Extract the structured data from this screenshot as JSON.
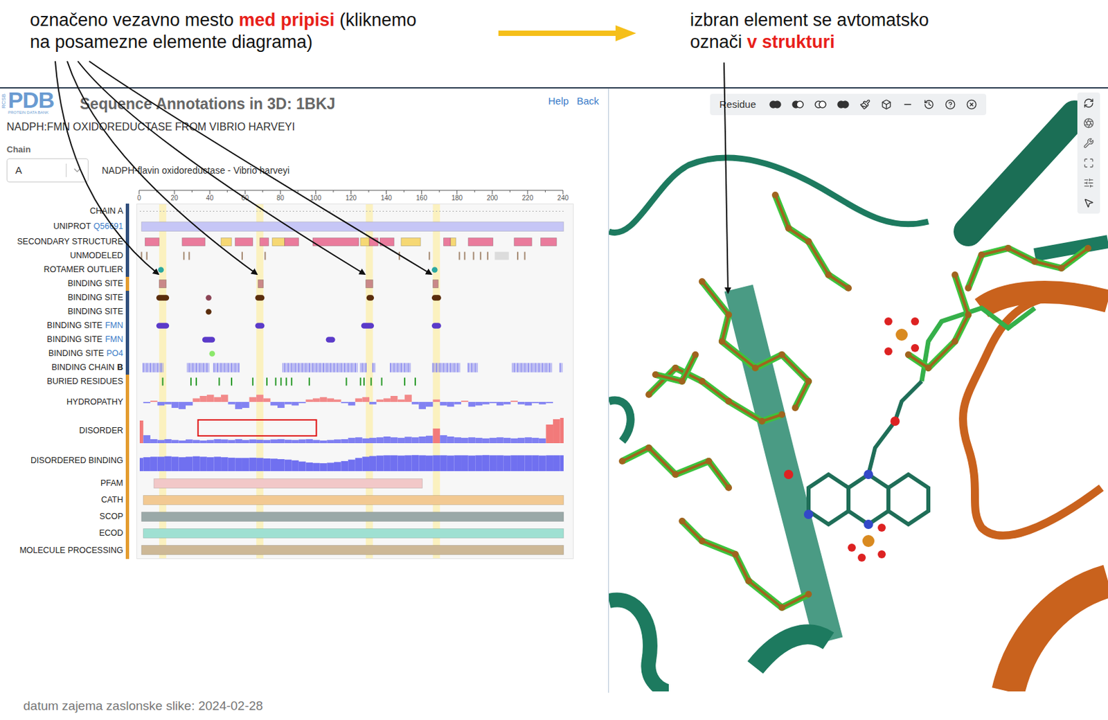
{
  "annotations": {
    "left": [
      [
        {
          "text": "označeno vezavno mesto ",
          "emphasis": false
        },
        {
          "text": "med pripisi",
          "emphasis": true
        },
        {
          "text": " (kliknemo",
          "emphasis": false
        }
      ],
      [
        {
          "text": "na posamezne elemente diagrama)",
          "emphasis": false
        }
      ]
    ],
    "right": [
      [
        {
          "text": "izbran element se avtomatsko",
          "emphasis": false
        }
      ],
      [
        {
          "text": "označi ",
          "emphasis": false
        },
        {
          "text": "v strukturi",
          "emphasis": true
        }
      ]
    ]
  },
  "header": {
    "logo_side": "RCSB",
    "logo_main": "PDB",
    "logo_sub": "PROTEIN DATA BANK",
    "title": "Sequence Annotations in 3D: 1BKJ",
    "links": [
      "Help",
      "Back"
    ]
  },
  "molecule": "NADPH:FMN OXIDOREDUCTASE FROM VIBRIO HARVEYI",
  "chain_select": {
    "label": "Chain",
    "value": "A",
    "description": "NADPH-flavin oxidoreductase - Vibrio harveyi"
  },
  "chart": {
    "axis_ticks": [
      "0",
      "20",
      "40",
      "60",
      "80",
      "100",
      "120",
      "140",
      "160",
      "180",
      "200",
      "220",
      "240"
    ],
    "highlights": [
      {
        "start": 11,
        "end": 15
      },
      {
        "start": 66,
        "end": 70
      },
      {
        "start": 128,
        "end": 132
      },
      {
        "start": 166,
        "end": 170
      }
    ],
    "tracks": [
      {
        "label": "CHAIN A",
        "group_color": "#2e4d7b",
        "kind": "line",
        "features": [
          {
            "start": 0,
            "end": 240,
            "color": "#b0b0b0"
          }
        ]
      },
      {
        "label": "UNIPROT",
        "tag": "Q56691",
        "tag_style": "link",
        "group_color": "#2e4d7b",
        "kind": "bar",
        "features": [
          {
            "start": 1,
            "end": 240,
            "color": "#c6c6f6"
          }
        ]
      },
      {
        "label": "SECONDARY STRUCTURE",
        "group_color": "#2e4d7b",
        "kind": "box",
        "features": [
          {
            "start": 3,
            "end": 11,
            "color": "#ea7b9c"
          },
          {
            "start": 24,
            "end": 37,
            "color": "#ea7b9c"
          },
          {
            "start": 46,
            "end": 52,
            "color": "#f6d874"
          },
          {
            "start": 54,
            "end": 64,
            "color": "#ea7b9c"
          },
          {
            "start": 68,
            "end": 73,
            "color": "#ea7b9c"
          },
          {
            "start": 75,
            "end": 82,
            "color": "#f6d874"
          },
          {
            "start": 82,
            "end": 90,
            "color": "#ea7b9c"
          },
          {
            "start": 98,
            "end": 124,
            "color": "#ea7b9c"
          },
          {
            "start": 125,
            "end": 130,
            "color": "#f6d874"
          },
          {
            "start": 130,
            "end": 135,
            "color": "#ea7b9c"
          },
          {
            "start": 136,
            "end": 144,
            "color": "#ea7b9c"
          },
          {
            "start": 148,
            "end": 159,
            "color": "#f6d874"
          },
          {
            "start": 172,
            "end": 176,
            "color": "#ea7b9c"
          },
          {
            "start": 176,
            "end": 179,
            "color": "#f6d874"
          },
          {
            "start": 186,
            "end": 200,
            "color": "#ea7b9c"
          },
          {
            "start": 212,
            "end": 222,
            "color": "#ea7b9c"
          },
          {
            "start": 227,
            "end": 236,
            "color": "#ea7b9c"
          }
        ]
      },
      {
        "label": "UNMODELED",
        "group_color": "#2e4d7b",
        "kind": "tick",
        "features": [
          {
            "start": 1,
            "end": 1,
            "color": "#a58a72"
          },
          {
            "start": 4,
            "end": 4,
            "color": "#a58a72"
          },
          {
            "start": 25,
            "end": 25,
            "color": "#a58a72"
          },
          {
            "start": 28,
            "end": 28,
            "color": "#a58a72"
          },
          {
            "start": 58,
            "end": 58,
            "color": "#a58a72"
          },
          {
            "start": 71,
            "end": 71,
            "color": "#a58a72"
          },
          {
            "start": 147,
            "end": 147,
            "color": "#a58a72"
          },
          {
            "start": 164,
            "end": 164,
            "color": "#a58a72"
          },
          {
            "start": 181,
            "end": 181,
            "color": "#a58a72"
          },
          {
            "start": 184,
            "end": 184,
            "color": "#a58a72"
          },
          {
            "start": 189,
            "end": 189,
            "color": "#a58a72"
          },
          {
            "start": 193,
            "end": 193,
            "color": "#a58a72"
          },
          {
            "start": 197,
            "end": 197,
            "color": "#a58a72"
          },
          {
            "start": 201,
            "end": 209,
            "color": "#dcdcdc"
          },
          {
            "start": 214,
            "end": 214,
            "color": "#a58a72"
          },
          {
            "start": 218,
            "end": 218,
            "color": "#a58a72"
          }
        ]
      },
      {
        "label": "ROTAMER OUTLIER",
        "group_color": "#2e4d7b",
        "kind": "dot",
        "features": [
          {
            "start": 12,
            "end": 12,
            "color": "#2aa8a0"
          },
          {
            "start": 167,
            "end": 167,
            "color": "#2aa8a0"
          }
        ]
      },
      {
        "label": "BINDING SITE",
        "group_color": "#e39b2d",
        "kind": "box",
        "features": [
          {
            "start": 11,
            "end": 15,
            "color": "#c98888"
          },
          {
            "start": 67,
            "end": 70,
            "color": "#c98888"
          },
          {
            "start": 128,
            "end": 132,
            "color": "#c98888"
          },
          {
            "start": 166,
            "end": 169,
            "color": "#c98888"
          }
        ]
      },
      {
        "label": "BINDING SITE",
        "group_color": "#2e4d7b",
        "kind": "dot",
        "features": [
          {
            "start": 11,
            "end": 15,
            "color": "#5a2d0c"
          },
          {
            "start": 39,
            "end": 39,
            "color": "#8b4455"
          },
          {
            "start": 67,
            "end": 69,
            "color": "#5a2d0c"
          },
          {
            "start": 130,
            "end": 131,
            "color": "#5a2d0c"
          },
          {
            "start": 167,
            "end": 169,
            "color": "#5a2d0c"
          }
        ]
      },
      {
        "label": "BINDING SITE",
        "group_color": "#2e4d7b",
        "kind": "dot",
        "features": [
          {
            "start": 39,
            "end": 39,
            "color": "#5a2d0c"
          }
        ]
      },
      {
        "label": "BINDING SITE",
        "tag": "FMN",
        "tag_style": "link",
        "group_color": "#2e4d7b",
        "kind": "dot",
        "features": [
          {
            "start": 11,
            "end": 15,
            "color": "#5b3bc9"
          },
          {
            "start": 67,
            "end": 69,
            "color": "#5b3bc9"
          },
          {
            "start": 127,
            "end": 131,
            "color": "#5b3bc9"
          },
          {
            "start": 167,
            "end": 169,
            "color": "#5b3bc9"
          }
        ]
      },
      {
        "label": "BINDING SITE",
        "tag": "FMN",
        "tag_style": "link",
        "group_color": "#2e4d7b",
        "kind": "dot",
        "features": [
          {
            "start": 37,
            "end": 41,
            "color": "#5b3bc9"
          },
          {
            "start": 107,
            "end": 109,
            "color": "#5b3bc9"
          }
        ]
      },
      {
        "label": "BINDING SITE",
        "tag": "PO4",
        "tag_style": "link",
        "group_color": "#2e4d7b",
        "kind": "dot",
        "features": [
          {
            "start": 41,
            "end": 41,
            "color": "#8be86b"
          }
        ]
      },
      {
        "label": "BINDING CHAIN",
        "tag": "B",
        "tag_style": "bold",
        "group_color": "#2e4d7b",
        "kind": "stripe",
        "features": [
          {
            "start": 2,
            "end": 13,
            "color": "#8888ee"
          },
          {
            "start": 27,
            "end": 39,
            "color": "#8888ee"
          },
          {
            "start": 42,
            "end": 56,
            "color": "#8888ee"
          },
          {
            "start": 81,
            "end": 123,
            "color": "#8888ee"
          },
          {
            "start": 125,
            "end": 128,
            "color": "#8888ee"
          },
          {
            "start": 132,
            "end": 133,
            "color": "#8888ee"
          },
          {
            "start": 142,
            "end": 153,
            "color": "#8888ee"
          },
          {
            "start": 166,
            "end": 181,
            "color": "#8888ee"
          },
          {
            "start": 186,
            "end": 191,
            "color": "#8888ee"
          },
          {
            "start": 211,
            "end": 233,
            "color": "#8888ee"
          },
          {
            "start": 238,
            "end": 239,
            "color": "#8888ee"
          }
        ]
      },
      {
        "label": "BURIED RESIDUES",
        "group_color": "#e39b2d",
        "kind": "tick",
        "features": [
          {
            "start": 13,
            "end": 13,
            "color": "#2a9a2a"
          },
          {
            "start": 29,
            "end": 29,
            "color": "#2a9a2a"
          },
          {
            "start": 32,
            "end": 32,
            "color": "#2a9a2a"
          },
          {
            "start": 45,
            "end": 45,
            "color": "#2a9a2a"
          },
          {
            "start": 52,
            "end": 52,
            "color": "#2a9a2a"
          },
          {
            "start": 64,
            "end": 64,
            "color": "#2a9a2a"
          },
          {
            "start": 72,
            "end": 72,
            "color": "#2a9a2a"
          },
          {
            "start": 77,
            "end": 77,
            "color": "#2a9a2a"
          },
          {
            "start": 80,
            "end": 80,
            "color": "#2a9a2a"
          },
          {
            "start": 83,
            "end": 83,
            "color": "#2a9a2a"
          },
          {
            "start": 86,
            "end": 86,
            "color": "#2a9a2a"
          },
          {
            "start": 96,
            "end": 96,
            "color": "#2a9a2a"
          },
          {
            "start": 117,
            "end": 117,
            "color": "#2a9a2a"
          },
          {
            "start": 125,
            "end": 125,
            "color": "#2a9a2a"
          },
          {
            "start": 127,
            "end": 127,
            "color": "#2a9a2a"
          },
          {
            "start": 131,
            "end": 131,
            "color": "#2a9a2a"
          },
          {
            "start": 137,
            "end": 137,
            "color": "#2a9a2a"
          },
          {
            "start": 150,
            "end": 150,
            "color": "#2a9a2a"
          },
          {
            "start": 156,
            "end": 156,
            "color": "#2a9a2a"
          }
        ]
      },
      {
        "label": "HYDROPATHY",
        "group_color": "#e39b2d",
        "kind": "diverging",
        "colors": {
          "positive": "#f28a8a",
          "negative": "#8282f2"
        },
        "values": [
          0.0,
          -0.1,
          0.1,
          -0.3,
          -0.2,
          -0.5,
          -0.6,
          -0.3,
          0.3,
          0.5,
          0.6,
          0.4,
          0.6,
          -0.2,
          -0.6,
          -0.5,
          0.4,
          0.6,
          0.3,
          -0.3,
          -0.5,
          -0.2,
          -0.3,
          -0.1,
          0.2,
          0.3,
          0.4,
          0.3,
          0.2,
          -0.1,
          -0.3,
          0.3,
          0.4,
          -0.2,
          0.2,
          0.3,
          0.5,
          0.2,
          0.6,
          -0.2,
          -0.6,
          -0.4,
          0.2,
          -0.3,
          -0.4,
          -0.2,
          0.1,
          -0.4,
          -0.3,
          -0.2,
          -0.1,
          -0.3,
          -0.2,
          0.1,
          -0.2,
          -0.3,
          -0.1,
          -0.2,
          -0.1,
          0.0,
          0.0
        ]
      },
      {
        "label": "DISORDER",
        "group_color": "#e39b2d",
        "kind": "profile",
        "threshold": 0.5,
        "colors": {
          "high": "#f27a7a",
          "low": "#7f7ff2"
        },
        "annotation_box": {
          "start": 33,
          "end": 100,
          "color": "#e01010"
        },
        "values": [
          0.85,
          0.3,
          0.15,
          0.12,
          0.15,
          0.12,
          0.1,
          0.14,
          0.12,
          0.1,
          0.12,
          0.15,
          0.14,
          0.12,
          0.15,
          0.12,
          0.14,
          0.13,
          0.12,
          0.14,
          0.15,
          0.13,
          0.12,
          0.14,
          0.15,
          0.12,
          0.1,
          0.12,
          0.14,
          0.15,
          0.2,
          0.22,
          0.18,
          0.2,
          0.22,
          0.25,
          0.22,
          0.2,
          0.24,
          0.22,
          0.25,
          0.28,
          0.55,
          0.3,
          0.25,
          0.22,
          0.2,
          0.22,
          0.2,
          0.18,
          0.2,
          0.22,
          0.2,
          0.18,
          0.2,
          0.22,
          0.2,
          0.18,
          0.7,
          0.9,
          0.95
        ]
      },
      {
        "label": "DISORDERED BINDING",
        "group_color": "#e39b2d",
        "kind": "area",
        "colors": {
          "fill": "#7070f0"
        },
        "values": [
          0.55,
          0.58,
          0.6,
          0.6,
          0.62,
          0.6,
          0.58,
          0.6,
          0.62,
          0.6,
          0.58,
          0.6,
          0.58,
          0.56,
          0.55,
          0.55,
          0.56,
          0.55,
          0.53,
          0.52,
          0.5,
          0.48,
          0.45,
          0.4,
          0.36,
          0.34,
          0.33,
          0.35,
          0.38,
          0.42,
          0.48,
          0.55,
          0.6,
          0.63,
          0.65,
          0.66,
          0.66,
          0.65,
          0.66,
          0.67,
          0.66,
          0.65,
          0.66,
          0.66,
          0.65,
          0.66,
          0.66,
          0.65,
          0.66,
          0.67,
          0.66,
          0.66,
          0.65,
          0.66,
          0.66,
          0.66,
          0.66,
          0.65,
          0.66,
          0.66,
          0.66
        ]
      },
      {
        "label": "PFAM",
        "group_color": "#e39b2d",
        "kind": "bar",
        "features": [
          {
            "start": 8,
            "end": 160,
            "color": "#f2c8c8"
          }
        ]
      },
      {
        "label": "CATH",
        "group_color": "#e39b2d",
        "kind": "bar",
        "features": [
          {
            "start": 2,
            "end": 240,
            "color": "#f2c992"
          }
        ]
      },
      {
        "label": "SCOP",
        "group_color": "#e39b2d",
        "kind": "bar",
        "features": [
          {
            "start": 1,
            "end": 240,
            "color": "#9aa9a8"
          }
        ]
      },
      {
        "label": "ECOD",
        "group_color": "#e39b2d",
        "kind": "bar",
        "features": [
          {
            "start": 2,
            "end": 240,
            "color": "#9fe0d2"
          }
        ]
      },
      {
        "label": "MOLECULE PROCESSING",
        "group_color": "#e39b2d",
        "kind": "bar",
        "features": [
          {
            "start": 1,
            "end": 240,
            "color": "#cdb896"
          }
        ]
      }
    ]
  },
  "viewer": {
    "mode": "Residue"
  },
  "footer": "datum zajema zaslonske slike: 2024-02-28"
}
